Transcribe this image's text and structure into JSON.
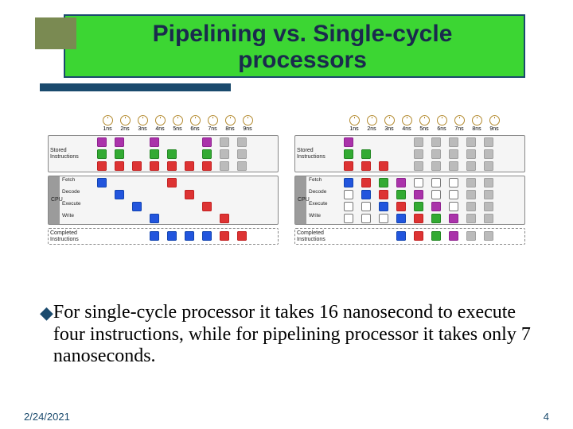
{
  "title": "Pipelining vs. Single-cycle processors",
  "time_labels": [
    "1ns",
    "2ns",
    "3ns",
    "4ns",
    "5ns",
    "6ns",
    "7ns",
    "8ns",
    "9ns"
  ],
  "panels": {
    "stored": "Stored Instructions",
    "cpu": "CPU",
    "completed": "Completed Instructions"
  },
  "stages": [
    "Fetch",
    "Decode",
    "Execute",
    "Write"
  ],
  "diagram_left": {
    "stored_rows": [
      [
        "p",
        "p",
        "",
        "p",
        "",
        "",
        "p",
        "gy",
        "gy"
      ],
      [
        "g",
        "g",
        "",
        "g",
        "g",
        "",
        "g",
        "gy",
        "gy"
      ],
      [
        "r",
        "r",
        "r",
        "r",
        "r",
        "r",
        "r",
        "gy",
        "gy"
      ]
    ],
    "cpu_rows": [
      [
        "b",
        "",
        "",
        "",
        "r",
        "",
        "",
        "",
        ""
      ],
      [
        "",
        "b",
        "",
        "",
        "",
        "r",
        "",
        "",
        ""
      ],
      [
        "",
        "",
        "b",
        "",
        "",
        "",
        "r",
        "",
        ""
      ],
      [
        "",
        "",
        "",
        "b",
        "",
        "",
        "",
        "r",
        ""
      ]
    ],
    "completed_row": [
      "",
      "",
      "",
      "b",
      "b",
      "b",
      "b",
      "r",
      "r"
    ]
  },
  "diagram_right": {
    "stored_rows": [
      [
        "p",
        "",
        "",
        "",
        "gy",
        "gy",
        "gy",
        "gy",
        "gy"
      ],
      [
        "g",
        "g",
        "",
        "",
        "gy",
        "gy",
        "gy",
        "gy",
        "gy"
      ],
      [
        "r",
        "r",
        "r",
        "",
        "gy",
        "gy",
        "gy",
        "gy",
        "gy"
      ]
    ],
    "cpu_rows": [
      [
        "b",
        "r",
        "g",
        "p",
        "w",
        "w",
        "w",
        "gy",
        "gy"
      ],
      [
        "w",
        "b",
        "r",
        "g",
        "p",
        "w",
        "w",
        "gy",
        "gy"
      ],
      [
        "w",
        "w",
        "b",
        "r",
        "g",
        "p",
        "w",
        "gy",
        "gy"
      ],
      [
        "w",
        "w",
        "w",
        "b",
        "r",
        "g",
        "p",
        "gy",
        "gy"
      ]
    ],
    "completed_row": [
      "",
      "",
      "",
      "b",
      "r",
      "g",
      "p",
      "gy",
      "gy"
    ]
  },
  "bullet": "For single-cycle processor it takes 16 nanosecond to execute four instructions, while for pipelining processor it takes only 7 nanoseconds.",
  "footer": {
    "date": "2/24/2021",
    "page": "4"
  }
}
